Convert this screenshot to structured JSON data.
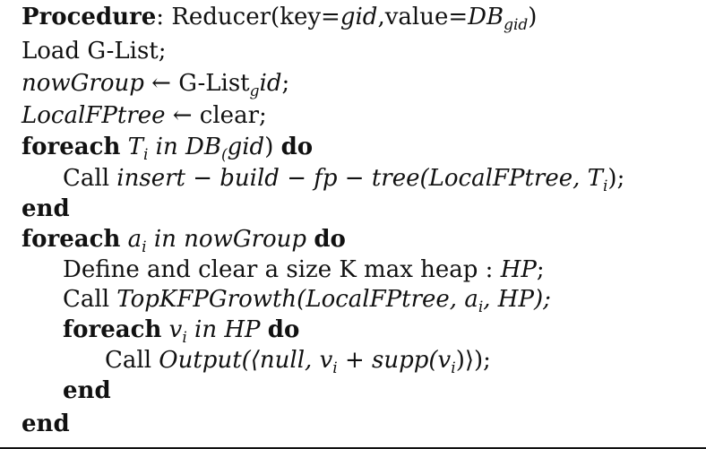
{
  "header": {
    "keyword": "Procedure",
    "colon": ":",
    "name": "Reducer(key=",
    "key_var": "gid",
    "mid": ",value=",
    "db_var": "DB",
    "db_sub": "gid",
    "close": ")"
  },
  "lines": {
    "l1": "Load G-List;",
    "l2_var": "nowGroup",
    "l2_rest": " ← G-List",
    "l2_sub": "g",
    "l2_tail_it": "id",
    "l2_end": ";",
    "l3_var": "LocalFPtree",
    "l3_rest": " ← clear;",
    "l4_kw1": "foreach",
    "l4_var": "T",
    "l4_sub": "i",
    "l4_in": "in DB",
    "l4_sub2": "(",
    "l4_gid": "gid",
    "l4_close": ")",
    "l4_kw2": "do",
    "l5_call": "Call ",
    "l5_expr": "insert − build − fp − tree(LocalFPtree, T",
    "l5_sub": "i",
    "l5_end": ");",
    "l6_kw": "end",
    "l7_kw1": "foreach",
    "l7_var": "a",
    "l7_sub": "i",
    "l7_in": "in nowGroup",
    "l7_kw2": "do",
    "l8_text": "Define and clear a size K max heap : ",
    "l8_var": "HP",
    "l8_end": ";",
    "l9_call": "Call ",
    "l9_expr": "TopKFPGrowth(LocalFPtree, a",
    "l9_sub": "i",
    "l9_end": ", HP);",
    "l10_kw1": "foreach",
    "l10_var": "v",
    "l10_sub": "i",
    "l10_in": "in HP",
    "l10_kw2": "do",
    "l11_call": "Call ",
    "l11_expr": "Output(⟨null, v",
    "l11_sub": "i",
    "l11_mid": " + supp(v",
    "l11_sub2": "i",
    "l11_end": ")⟩);",
    "l12_kw": "end",
    "l13_kw": "end"
  }
}
